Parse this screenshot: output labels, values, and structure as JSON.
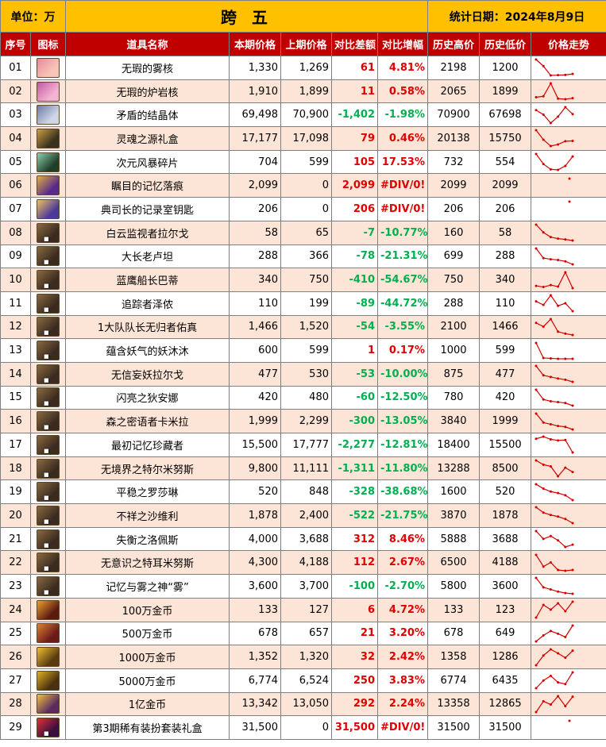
{
  "header": {
    "unit_label": "单位：万",
    "title": "跨 五",
    "date_label": "统计日期：2024年8月9日"
  },
  "columns": [
    "序号",
    "图标",
    "道具名称",
    "本期价格",
    "上期价格",
    "对比差额",
    "对比增幅",
    "历史高价",
    "历史低价",
    "价格走势"
  ],
  "colors": {
    "title_bg": "#ffc000",
    "header_bg": "#c00000",
    "row_alt_bg": "#fce4d6",
    "increase": "#e00000",
    "decrease": "#00b050",
    "trend_line": "#d40000"
  },
  "rows": [
    {
      "no": "01",
      "name": "无瑕的雾核",
      "cur": "1,330",
      "prev": "1,269",
      "diff": "61",
      "pct": "4.81%",
      "dir": "up",
      "high": "2198",
      "low": "1200",
      "icon": "pink-rose-gem-icon",
      "trend": [
        2198,
        1800,
        1240,
        1255,
        1269,
        1330
      ]
    },
    {
      "no": "02",
      "name": "无瑕的炉岩核",
      "cur": "1,910",
      "prev": "1,899",
      "diff": "11",
      "pct": "0.58%",
      "dir": "up",
      "high": "2065",
      "low": "1899",
      "icon": "pink-flower-gem-icon",
      "trend": [
        1920,
        1930,
        2065,
        1905,
        1899,
        1910
      ]
    },
    {
      "no": "03",
      "name": "矛盾的结晶体",
      "cur": "69,498",
      "prev": "70,900",
      "diff": "-1,402",
      "pct": "-1.98%",
      "dir": "down",
      "high": "70900",
      "low": "67698",
      "icon": "crystal-icon",
      "trend": [
        70300,
        69400,
        67698,
        69000,
        70900,
        69498
      ]
    },
    {
      "no": "04",
      "name": "灵魂之源礼盒",
      "cur": "17,177",
      "prev": "17,098",
      "diff": "79",
      "pct": "0.46%",
      "dir": "up",
      "high": "20138",
      "low": "15750",
      "icon": "soul-box-icon",
      "trend": [
        20138,
        17500,
        15750,
        16200,
        17098,
        17177
      ]
    },
    {
      "no": "05",
      "name": "次元风暴碎片",
      "cur": "704",
      "prev": "599",
      "diff": "105",
      "pct": "17.53%",
      "dir": "up",
      "high": "732",
      "low": "554",
      "icon": "storm-shard-icon",
      "trend": [
        732,
        620,
        560,
        554,
        599,
        704
      ]
    },
    {
      "no": "06",
      "name": "瞩目的记忆落痕",
      "cur": "2,099",
      "prev": "0",
      "diff": "2,099",
      "pct": "#DIV/0!",
      "dir": "up",
      "high": "2099",
      "low": "2099",
      "icon": "memory-trace-icon",
      "trend": [
        2099
      ]
    },
    {
      "no": "07",
      "name": "典司长的记录室钥匙",
      "cur": "206",
      "prev": "0",
      "diff": "206",
      "pct": "#DIV/0!",
      "dir": "up",
      "high": "206",
      "low": "206",
      "icon": "record-key-icon",
      "trend": [
        206
      ]
    },
    {
      "no": "08",
      "name": "白云监视者拉尔戈",
      "cur": "58",
      "prev": "65",
      "diff": "-7",
      "pct": "-10.77%",
      "dir": "down",
      "high": "160",
      "low": "58",
      "icon": "card-largo-icon",
      "trend": [
        160,
        110,
        80,
        70,
        65,
        58
      ]
    },
    {
      "no": "09",
      "name": "大长老卢坦",
      "cur": "288",
      "prev": "366",
      "diff": "-78",
      "pct": "-21.31%",
      "dir": "down",
      "high": "699",
      "low": "288",
      "icon": "card-lutan-icon",
      "trend": [
        699,
        450,
        420,
        400,
        366,
        288
      ]
    },
    {
      "no": "10",
      "name": "蓝鹰船长巴蒂",
      "cur": "340",
      "prev": "750",
      "diff": "-410",
      "pct": "-54.67%",
      "dir": "down",
      "high": "750",
      "low": "340",
      "icon": "card-batty-icon",
      "trend": [
        400,
        370,
        420,
        380,
        750,
        340
      ]
    },
    {
      "no": "11",
      "name": "追踪者泽侬",
      "cur": "110",
      "prev": "199",
      "diff": "-89",
      "pct": "-44.72%",
      "dir": "down",
      "high": "288",
      "low": "110",
      "icon": "card-zenon-icon",
      "trend": [
        220,
        180,
        288,
        170,
        199,
        110
      ]
    },
    {
      "no": "12",
      "name": "1大队队长无归者佑真",
      "cur": "1,466",
      "prev": "1,520",
      "diff": "-54",
      "pct": "-3.55%",
      "dir": "down",
      "high": "2100",
      "low": "1466",
      "icon": "card-yuzhen-icon",
      "trend": [
        1950,
        1800,
        2100,
        1600,
        1520,
        1466
      ]
    },
    {
      "no": "13",
      "name": "蕴含妖气的妖沐沐",
      "cur": "600",
      "prev": "599",
      "diff": "1",
      "pct": "0.17%",
      "dir": "up",
      "high": "1000",
      "low": "599",
      "icon": "card-mumu-icon",
      "trend": [
        1000,
        620,
        610,
        600,
        599,
        600
      ]
    },
    {
      "no": "14",
      "name": "无信妄妖拉尔戈",
      "cur": "477",
      "prev": "530",
      "diff": "-53",
      "pct": "-10.00%",
      "dir": "down",
      "high": "875",
      "low": "477",
      "icon": "card-largo-demon-icon",
      "trend": [
        875,
        640,
        600,
        560,
        530,
        477
      ]
    },
    {
      "no": "15",
      "name": "闪亮之狄安娜",
      "cur": "420",
      "prev": "480",
      "diff": "-60",
      "pct": "-12.50%",
      "dir": "down",
      "high": "780",
      "low": "420",
      "icon": "card-diana-icon",
      "trend": [
        780,
        560,
        520,
        500,
        480,
        420
      ]
    },
    {
      "no": "16",
      "name": "森之密语者卡米拉",
      "cur": "1,999",
      "prev": "2,299",
      "diff": "-300",
      "pct": "-13.05%",
      "dir": "down",
      "high": "3840",
      "low": "1999",
      "icon": "card-camilla-icon",
      "trend": [
        3840,
        2800,
        2600,
        2400,
        2299,
        1999
      ]
    },
    {
      "no": "17",
      "name": "最初记忆珍藏者",
      "cur": "15,500",
      "prev": "17,777",
      "diff": "-2,277",
      "pct": "-12.81%",
      "dir": "down",
      "high": "18400",
      "low": "15500",
      "icon": "card-collector-icon",
      "trend": [
        18000,
        18400,
        17900,
        17700,
        17777,
        15500
      ]
    },
    {
      "no": "18",
      "name": "无境界之特尔米努斯",
      "cur": "9,800",
      "prev": "11,111",
      "diff": "-1,311",
      "pct": "-11.80%",
      "dir": "down",
      "high": "13288",
      "low": "8500",
      "icon": "card-terminus-icon",
      "trend": [
        13288,
        12000,
        11500,
        8500,
        11111,
        9800
      ]
    },
    {
      "no": "19",
      "name": "平稳之罗莎琳",
      "cur": "520",
      "prev": "848",
      "diff": "-328",
      "pct": "-38.68%",
      "dir": "down",
      "high": "1600",
      "low": "520",
      "icon": "card-rosalyn-icon",
      "trend": [
        1600,
        1300,
        1100,
        1000,
        848,
        520
      ]
    },
    {
      "no": "20",
      "name": "不祥之沙维利",
      "cur": "1,878",
      "prev": "2,400",
      "diff": "-522",
      "pct": "-21.75%",
      "dir": "down",
      "high": "3870",
      "low": "1878",
      "icon": "card-savili-icon",
      "trend": [
        3870,
        3200,
        2900,
        2700,
        2400,
        1878
      ]
    },
    {
      "no": "21",
      "name": "失衡之洛佩斯",
      "cur": "4,000",
      "prev": "3,688",
      "diff": "312",
      "pct": "8.46%",
      "dir": "up",
      "high": "5888",
      "low": "3688",
      "icon": "card-lopez-icon",
      "trend": [
        5888,
        4800,
        5200,
        4600,
        3688,
        4000
      ]
    },
    {
      "no": "22",
      "name": "无意识之特耳米努斯",
      "cur": "4,300",
      "prev": "4,188",
      "diff": "112",
      "pct": "2.67%",
      "dir": "up",
      "high": "6500",
      "low": "4188",
      "icon": "card-termius-icon",
      "trend": [
        6500,
        4800,
        5400,
        4300,
        4188,
        4300
      ]
    },
    {
      "no": "23",
      "name": "记忆与雾之神“雾”",
      "cur": "3,600",
      "prev": "3,700",
      "diff": "-100",
      "pct": "-2.70%",
      "dir": "down",
      "high": "5800",
      "low": "3600",
      "icon": "card-mist-god-icon",
      "trend": [
        5800,
        4500,
        4200,
        3900,
        3700,
        3600
      ]
    },
    {
      "no": "24",
      "name": "100万金币",
      "cur": "133",
      "prev": "127",
      "diff": "6",
      "pct": "4.72%",
      "dir": "up",
      "high": "133",
      "low": "123",
      "icon": "coin-pile-icon",
      "trend": [
        123,
        131,
        128,
        132,
        127,
        133
      ]
    },
    {
      "no": "25",
      "name": "500万金币",
      "cur": "678",
      "prev": "657",
      "diff": "21",
      "pct": "3.20%",
      "dir": "up",
      "high": "678",
      "low": "649",
      "icon": "coin-bag-icon",
      "trend": [
        649,
        660,
        668,
        663,
        657,
        678
      ]
    },
    {
      "no": "26",
      "name": "1000万金币",
      "cur": "1,352",
      "prev": "1,320",
      "diff": "32",
      "pct": "2.42%",
      "dir": "up",
      "high": "1358",
      "low": "1286",
      "icon": "gold-ingot-icon",
      "trend": [
        1286,
        1330,
        1358,
        1340,
        1320,
        1352
      ]
    },
    {
      "no": "27",
      "name": "5000万金币",
      "cur": "6,774",
      "prev": "6,524",
      "diff": "250",
      "pct": "3.83%",
      "dir": "up",
      "high": "6774",
      "low": "6435",
      "icon": "gold-bar-icon",
      "trend": [
        6435,
        6600,
        6700,
        6560,
        6524,
        6774
      ]
    },
    {
      "no": "28",
      "name": "1亿金币",
      "cur": "13,342",
      "prev": "13,050",
      "diff": "292",
      "pct": "2.24%",
      "dir": "up",
      "high": "13358",
      "low": "12865",
      "icon": "gold-treasure-icon",
      "trend": [
        12865,
        13200,
        13100,
        13358,
        13050,
        13342
      ]
    },
    {
      "no": "29",
      "name": "第3期稀有装扮套装礼盒",
      "cur": "31,500",
      "prev": "0",
      "diff": "31,500",
      "pct": "#DIV/0!",
      "dir": "up",
      "high": "31500",
      "low": "31500",
      "icon": "avatar-gift-box-icon",
      "trend": [
        31500
      ]
    }
  ]
}
